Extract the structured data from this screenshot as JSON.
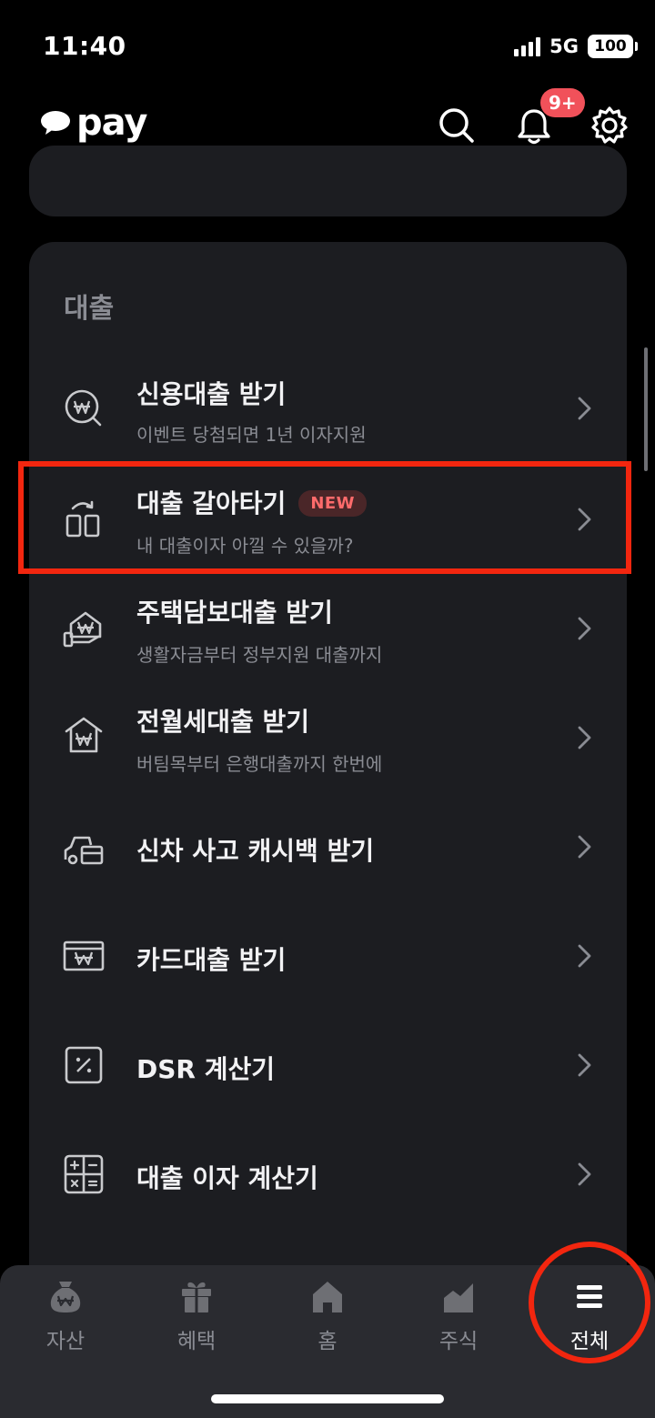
{
  "status": {
    "time": "11:40",
    "network": "5G",
    "battery": "100"
  },
  "header": {
    "logo_text": "pay",
    "notification_badge": "9+",
    "icons": [
      "search-icon",
      "bell-icon",
      "gear-icon"
    ]
  },
  "loan_section": {
    "title": "대출",
    "items": [
      {
        "title": "신용대출 받기",
        "subtitle": "이벤트 당첨되면 1년 이자지원",
        "icon": "won-search-icon"
      },
      {
        "title": "대출 갈아타기",
        "badge": "NEW",
        "subtitle": "내 대출이자 아낄 수 있을까?",
        "icon": "transfer-icon"
      },
      {
        "title": "주택담보대출 받기",
        "subtitle": "생활자금부터 정부지원 대출까지",
        "icon": "house-hand-icon"
      },
      {
        "title": "전월세대출 받기",
        "subtitle": "버팀목부터 은행대출까지 한번에",
        "icon": "house-won-icon"
      },
      {
        "title": "신차 사고 캐시백 받기",
        "icon": "car-icon"
      },
      {
        "title": "카드대출 받기",
        "icon": "card-won-icon"
      },
      {
        "title": "DSR 계산기",
        "icon": "percent-icon"
      },
      {
        "title": "대출 이자 계산기",
        "icon": "calculator-icon"
      }
    ]
  },
  "bottom_nav": {
    "items": [
      {
        "label": "자산",
        "icon": "money-bag-icon"
      },
      {
        "label": "혜택",
        "icon": "gift-icon"
      },
      {
        "label": "홈",
        "icon": "home-icon"
      },
      {
        "label": "주식",
        "icon": "chart-icon"
      },
      {
        "label": "전체",
        "icon": "menu-icon",
        "active": true
      }
    ]
  },
  "colors": {
    "background": "#000000",
    "card": "#1c1d21",
    "badge_red": "#f1515a",
    "highlight_red": "#f2260f",
    "new_badge_text": "#ff6b6b",
    "subtext": "#8a8c93"
  }
}
